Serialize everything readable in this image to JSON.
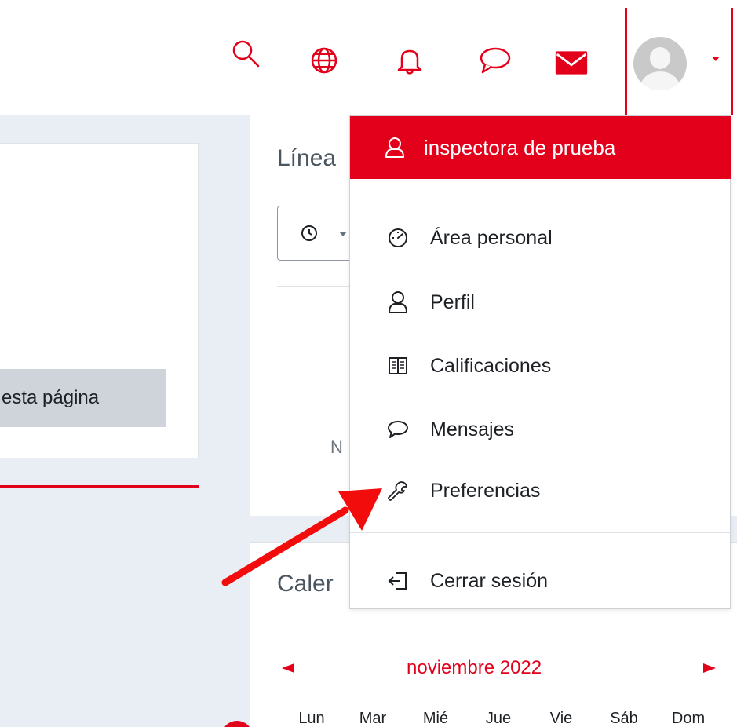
{
  "colors": {
    "accent": "#e2001a",
    "text": "#1d2125",
    "muted_title": "#4a5560",
    "page_bg": "#e9eef5"
  },
  "navbar": {
    "icons": [
      "search-icon",
      "language-icon",
      "notifications-icon",
      "messages-icon",
      "mail-icon"
    ],
    "user_menu_caret": "chevron-down-icon"
  },
  "left_panel": {
    "edit_button_label": "esta página"
  },
  "timeline": {
    "title": "Línea",
    "nothing_text": "N"
  },
  "calendar": {
    "title": "Caler",
    "month": "noviembre 2022",
    "days": [
      "Lun",
      "Mar",
      "Mié",
      "Jue",
      "Vie",
      "Sáb",
      "Dom"
    ]
  },
  "user_menu": {
    "header": {
      "name": "inspectora de prueba",
      "icon": "user-icon"
    },
    "items": [
      {
        "label": "Área personal",
        "icon": "dashboard-icon"
      },
      {
        "label": "Perfil",
        "icon": "user-icon"
      },
      {
        "label": "Calificaciones",
        "icon": "grades-icon"
      },
      {
        "label": "Mensajes",
        "icon": "message-icon"
      },
      {
        "label": "Preferencias",
        "icon": "wrench-icon"
      }
    ],
    "logout": {
      "label": "Cerrar sesión",
      "icon": "logout-icon"
    }
  }
}
